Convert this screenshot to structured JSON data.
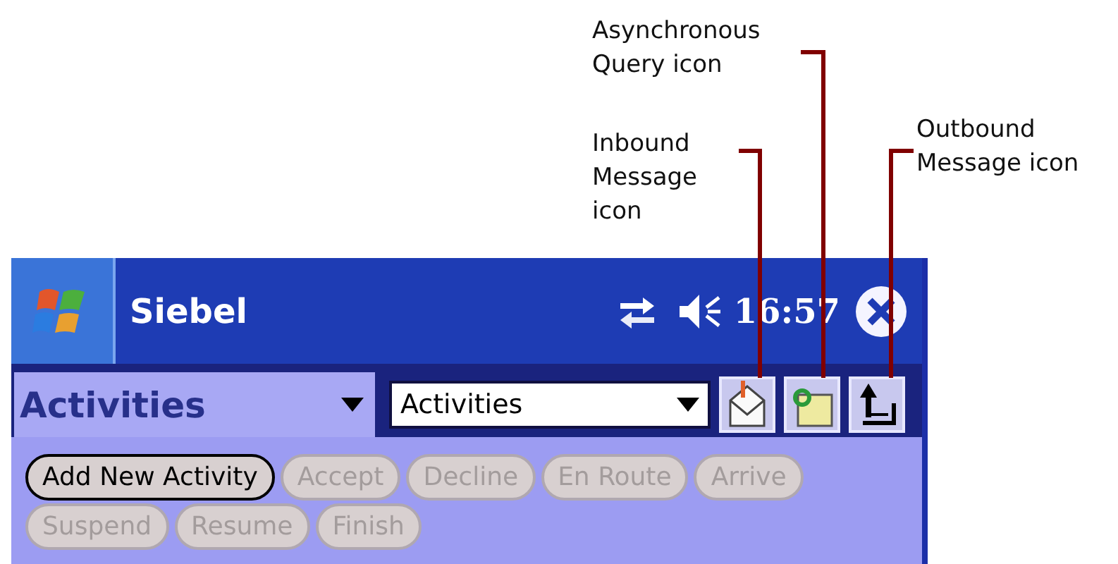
{
  "annotations": [
    {
      "kind": "async",
      "text": "Asynchronous Query icon"
    },
    {
      "kind": "inbound",
      "text": "Inbound Message icon"
    },
    {
      "kind": "outbound",
      "text": "Outbound Message icon"
    }
  ],
  "title_bar": {
    "app_title": "Siebel",
    "clock": "16:57"
  },
  "view_tab": {
    "label": "Activities"
  },
  "view_selector": {
    "value": "Activities"
  },
  "sync_icons": [
    {
      "kind": "inbound"
    },
    {
      "kind": "async"
    },
    {
      "kind": "outbound"
    }
  ],
  "action_buttons": [
    {
      "label": "Add New Activity",
      "disabled": false
    },
    {
      "label": "Accept",
      "disabled": true
    },
    {
      "label": "Decline",
      "disabled": true
    },
    {
      "label": "En Route",
      "disabled": true
    },
    {
      "label": "Arrive",
      "disabled": true
    },
    {
      "label": "Suspend",
      "disabled": true
    },
    {
      "label": "Resume",
      "disabled": true
    },
    {
      "label": "Finish",
      "disabled": true
    }
  ]
}
